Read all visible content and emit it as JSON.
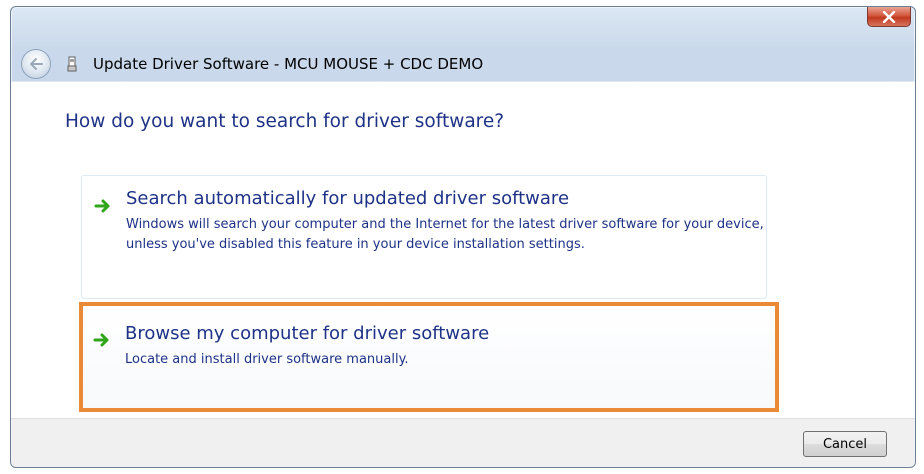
{
  "window": {
    "title": "Update Driver Software - MCU MOUSE + CDC DEMO"
  },
  "main": {
    "heading": "How do you want to search for driver software?",
    "options": [
      {
        "title": "Search automatically for updated driver software",
        "description": "Windows will search your computer and the Internet for the latest driver software for your device, unless you've disabled this feature in your device installation settings."
      },
      {
        "title": "Browse my computer for driver software",
        "description": "Locate and install driver software manually."
      }
    ]
  },
  "footer": {
    "cancel_label": "Cancel"
  },
  "colors": {
    "link_text": "#1e3287",
    "highlight_border": "#ea8a36",
    "arrow_green": "#2fa51a",
    "close_red": "#c0391f"
  },
  "icons": {
    "back": "back-arrow-icon",
    "device": "usb-device-icon",
    "option_arrow": "green-arrow-icon",
    "close": "close-icon"
  }
}
